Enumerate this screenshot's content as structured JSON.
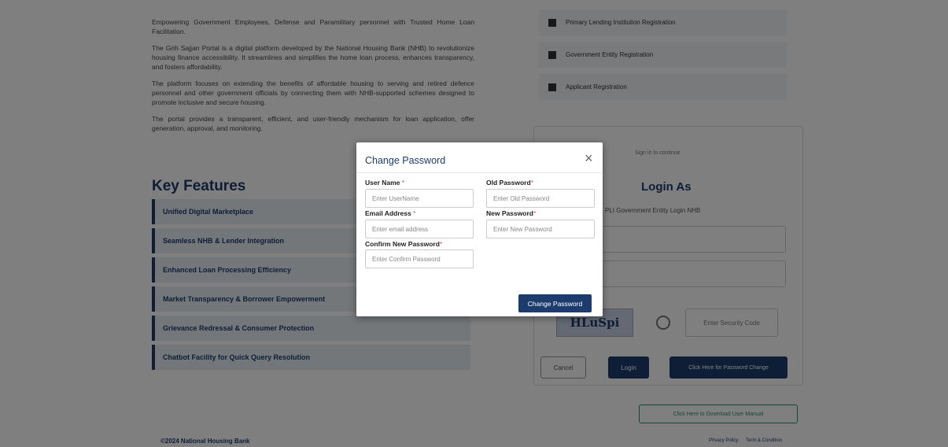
{
  "background": {
    "intro_paragraphs": [
      "Empowering Government Employees, Defense and Paramilitary personnel with Trusted Home Loan Facilitation.",
      "The Grih Sajjan Portal is a digital platform developed by the National Housing Bank (NHB) to revolutionize housing finance accessibility. It streamlines and simplifies the home loan process, enhances transparency, and fosters affordability.",
      "The platform focuses on extending the benefits of affordable housing to serving and retired defence personnel and other government officials by connecting them with NHB-supported schemes designed to promote inclusive and secure housing.",
      "The portal provides a transparent, efficient, and user-friendly mechanism for loan application, offer generation, approval, and monitoring."
    ],
    "key_features_title": "Key Features",
    "key_features": [
      "Unified Digital Marketplace",
      "Seamless NHB & Lender Integration",
      "Enhanced Loan Processing Efficiency",
      "Market Transparency & Borrower Empowerment",
      "Grievance Redressal & Consumer Protection",
      "Chatbot Facility for Quick Query Resolution"
    ],
    "registrations": [
      "Primary Lending Institution Registration",
      "Government Entity Registration",
      "Applicant Registration"
    ],
    "login": {
      "small_text": "Sign in to continue",
      "title": "Login As",
      "radio_text": "PLI   Government Entity Login   NHB",
      "captcha_text": "HLuSpi",
      "security_code_placeholder": "Enter Security Code",
      "cancel_label": "Cancel",
      "login_label": "Login",
      "forgot_label": "Click Here for Password Change"
    },
    "manual_label": "Click Here to Download User Manual",
    "footer_copyright": "©2024 National Housing Bank",
    "footer_privacy": "Privacy Policy",
    "footer_terms": "Term & Condition"
  },
  "modal": {
    "title": "Change Password",
    "close_glyph": "×",
    "username_label": "User Name",
    "username_placeholder": "Enter UserName",
    "old_password_label": "Old Password",
    "old_password_placeholder": "Enter Old Password",
    "email_label": "Email Address",
    "email_placeholder": "Enter email address",
    "new_password_label": "New Password",
    "new_password_placeholder": "Enter New Password",
    "confirm_password_label": "Confirm New Password",
    "confirm_password_placeholder": "Enter Confirm Password",
    "required_mark": "*",
    "submit_label": "Change Password"
  },
  "colors": {
    "primary": "#1d3c6e",
    "required": "#d9534f",
    "overlay": "rgba(0,0,0,0.5)"
  }
}
